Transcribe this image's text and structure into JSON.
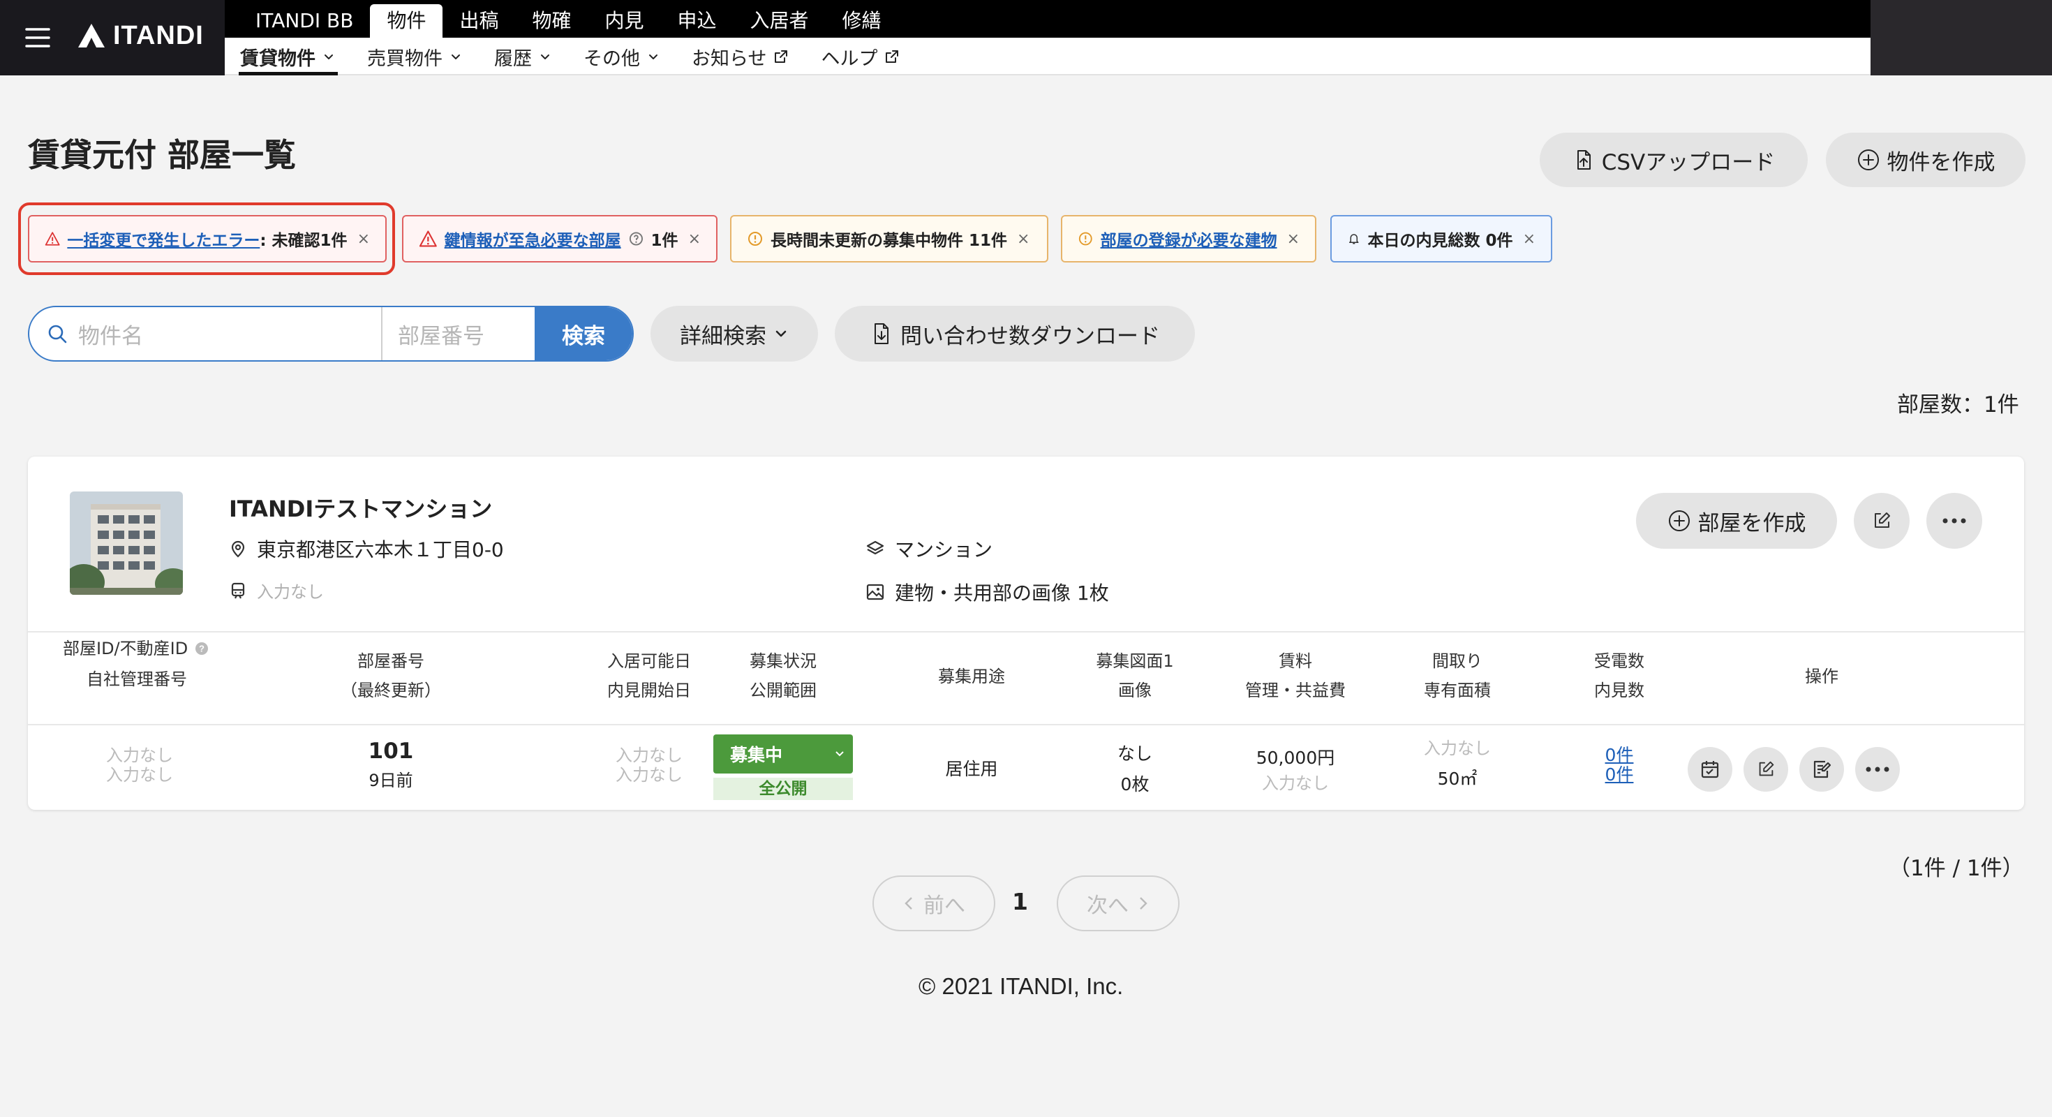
{
  "header": {
    "logo": "ITANDI",
    "top_tabs": [
      "ITANDI BB",
      "物件",
      "出稿",
      "物確",
      "内見",
      "申込",
      "入居者",
      "修繕"
    ],
    "sub_nav": [
      {
        "label": "賃貸物件",
        "icon": "chevron-down-icon"
      },
      {
        "label": "売買物件",
        "icon": "chevron-down-icon"
      },
      {
        "label": "履歴",
        "icon": "chevron-down-icon"
      },
      {
        "label": "その他",
        "icon": "chevron-down-icon"
      },
      {
        "label": "お知らせ",
        "icon": "external-link-icon"
      },
      {
        "label": "ヘルプ",
        "icon": "external-link-icon"
      }
    ]
  },
  "page": {
    "title": "賃貸元付 部屋一覧",
    "csv_upload": "CSVアップロード",
    "create_property": "物件を作成"
  },
  "alerts": [
    {
      "link": "一括変更で発生したエラー",
      "text": ": 未確認1件"
    },
    {
      "link": "鍵情報が至急必要な部屋",
      "text": "1件"
    },
    {
      "text": "長時間未更新の募集中物件 11件"
    },
    {
      "link": "部屋の登録が必要な建物"
    },
    {
      "text": "本日の内見総数 0件"
    }
  ],
  "alert_close": "×",
  "search": {
    "name_placeholder": "物件名",
    "room_placeholder": "部屋番号",
    "button": "検索",
    "detail": "詳細検索",
    "download": "問い合わせ数ダウンロード"
  },
  "room_count": "部屋数：1件",
  "property": {
    "name": "ITANDIテストマンション",
    "address": "東京都港区六本木１丁目0-0",
    "station": "入力なし",
    "type": "マンション",
    "images": "建物・共用部の画像 1枚",
    "create_room": "部屋を作成"
  },
  "table": {
    "headers": {
      "room_id": "部屋ID/不動産ID",
      "room_id_sub": "自社管理番号",
      "room_no": "部屋番号",
      "room_no_sub": "（最終更新）",
      "move_in": "入居可能日",
      "move_in_sub": "内見開始日",
      "status": "募集状況",
      "status_sub": "公開範囲",
      "usage": "募集用途",
      "plan": "募集図面1",
      "plan_sub": "画像",
      "rent": "賃料",
      "rent_sub": "管理・共益費",
      "layout": "間取り",
      "layout_sub": "専有面積",
      "calls": "受電数",
      "calls_sub": "内見数",
      "ops": "操作"
    },
    "row": {
      "room_id": "入力なし",
      "room_id_sub": "入力なし",
      "room_no": "101",
      "updated": "9日前",
      "move_in": "入力なし",
      "move_in_sub": "入力なし",
      "status": "募集中",
      "scope": "全公開",
      "usage": "居住用",
      "plan": "なし",
      "images": "0枚",
      "rent": "50,000円",
      "fee": "入力なし",
      "layout": "入力なし",
      "area": "50㎡",
      "calls": "0件",
      "viewings": "0件"
    }
  },
  "pagination": {
    "total": "（1件 / 1件）",
    "prev": "前へ",
    "page": "1",
    "next": "次へ"
  },
  "footer": "© 2021 ITANDI, Inc."
}
